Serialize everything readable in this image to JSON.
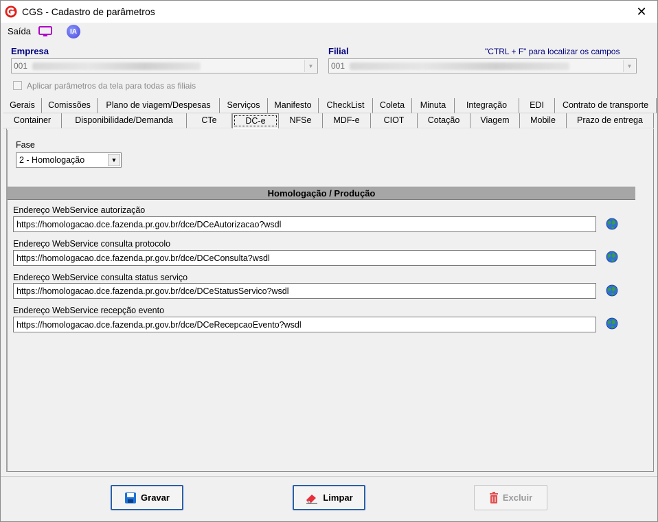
{
  "window": {
    "title": "CGS - Cadastro de parâmetros",
    "close_glyph": "✕"
  },
  "menu": {
    "saida": "Saída",
    "ia_label": "IA"
  },
  "empresa": {
    "label": "Empresa",
    "value": "001"
  },
  "filial": {
    "label": "Filial",
    "value": "001"
  },
  "hint": "\"CTRL + F\" para localizar os campos",
  "apply_all": {
    "label": "Aplicar parâmetros da tela para todas as filiais",
    "checked": false
  },
  "tabs_row1": [
    "Gerais",
    "Comissões",
    "Plano de viagem/Despesas",
    "Serviços",
    "Manifesto",
    "CheckList",
    "Coleta",
    "Minuta",
    "Integração",
    "EDI",
    "Contrato de transporte"
  ],
  "tabs_row2": [
    "Container",
    "Disponibilidade/Demanda",
    "CTe",
    "DC-e",
    "NFSe",
    "MDF-e",
    "CIOT",
    "Cotação",
    "Viagem",
    "Mobile",
    "Prazo de entrega"
  ],
  "active_tab": "DC-e",
  "fase": {
    "label": "Fase",
    "value": "2 - Homologação"
  },
  "section": {
    "title": "Homologação / Produção"
  },
  "ws": [
    {
      "label": "Endereço WebService autorização",
      "value": "https://homologacao.dce.fazenda.pr.gov.br/dce/DCeAutorizacao?wsdl"
    },
    {
      "label": "Endereço WebService consulta protocolo",
      "value": "https://homologacao.dce.fazenda.pr.gov.br/dce/DCeConsulta?wsdl"
    },
    {
      "label": "Endereço WebService consulta status serviço",
      "value": "https://homologacao.dce.fazenda.pr.gov.br/dce/DCeStatusServico?wsdl"
    },
    {
      "label": "Endereço WebService recepção evento",
      "value": "https://homologacao.dce.fazenda.pr.gov.br/dce/DCeRecepcaoEvento?wsdl"
    }
  ],
  "buttons": {
    "gravar": "Gravar",
    "limpar": "Limpar",
    "excluir": "Excluir"
  },
  "colors": {
    "label_blue": "#000080",
    "button_border": "#2a5fa8",
    "section_gray": "#a6a6a6"
  }
}
